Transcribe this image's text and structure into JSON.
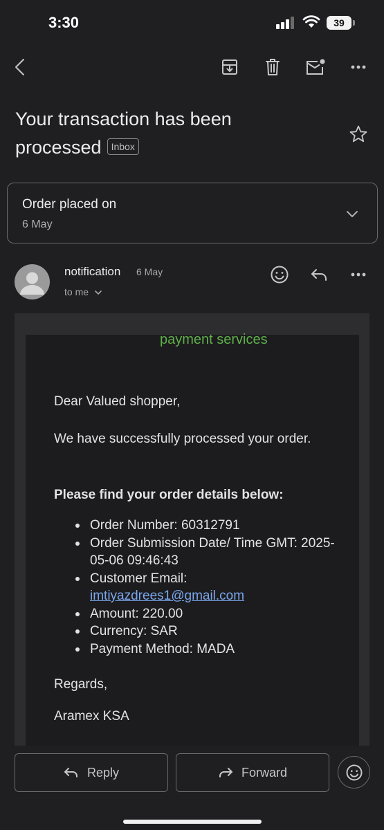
{
  "status": {
    "time": "3:30",
    "battery": "39"
  },
  "toolbar": {
    "back": "back",
    "archive": "archive",
    "delete": "delete",
    "mark_unread": "mark-unread",
    "more": "more"
  },
  "email": {
    "subject": "Your transaction has been processed",
    "label": "Inbox",
    "summary": {
      "title": "Order placed on",
      "date": "6 May"
    },
    "sender": {
      "name": "notification",
      "date": "6 May",
      "to": "to me"
    },
    "body": {
      "brand": "payment services",
      "greeting": "Dear Valued shopper,",
      "message": "We have successfully processed your order.",
      "details_heading": "Please find your order details below:",
      "details": [
        {
          "text": "Order Number: 60312791"
        },
        {
          "text": "Order Submission Date/ Time GMT: 2025-05-06 09:46:43"
        },
        {
          "label": "Customer Email:",
          "link": "imtiyazdrees1@gmail.com"
        },
        {
          "text": "Amount: 220.00"
        },
        {
          "text": "Currency: SAR"
        },
        {
          "text": "Payment Method: MADA"
        }
      ],
      "regards": "Regards,",
      "signoff": "Aramex KSA"
    }
  },
  "actions": {
    "reply": "Reply",
    "forward": "Forward"
  },
  "colors": {
    "background": "#1f1f21",
    "brand_green": "#5fb04a",
    "link_blue": "#7aa7ee"
  }
}
